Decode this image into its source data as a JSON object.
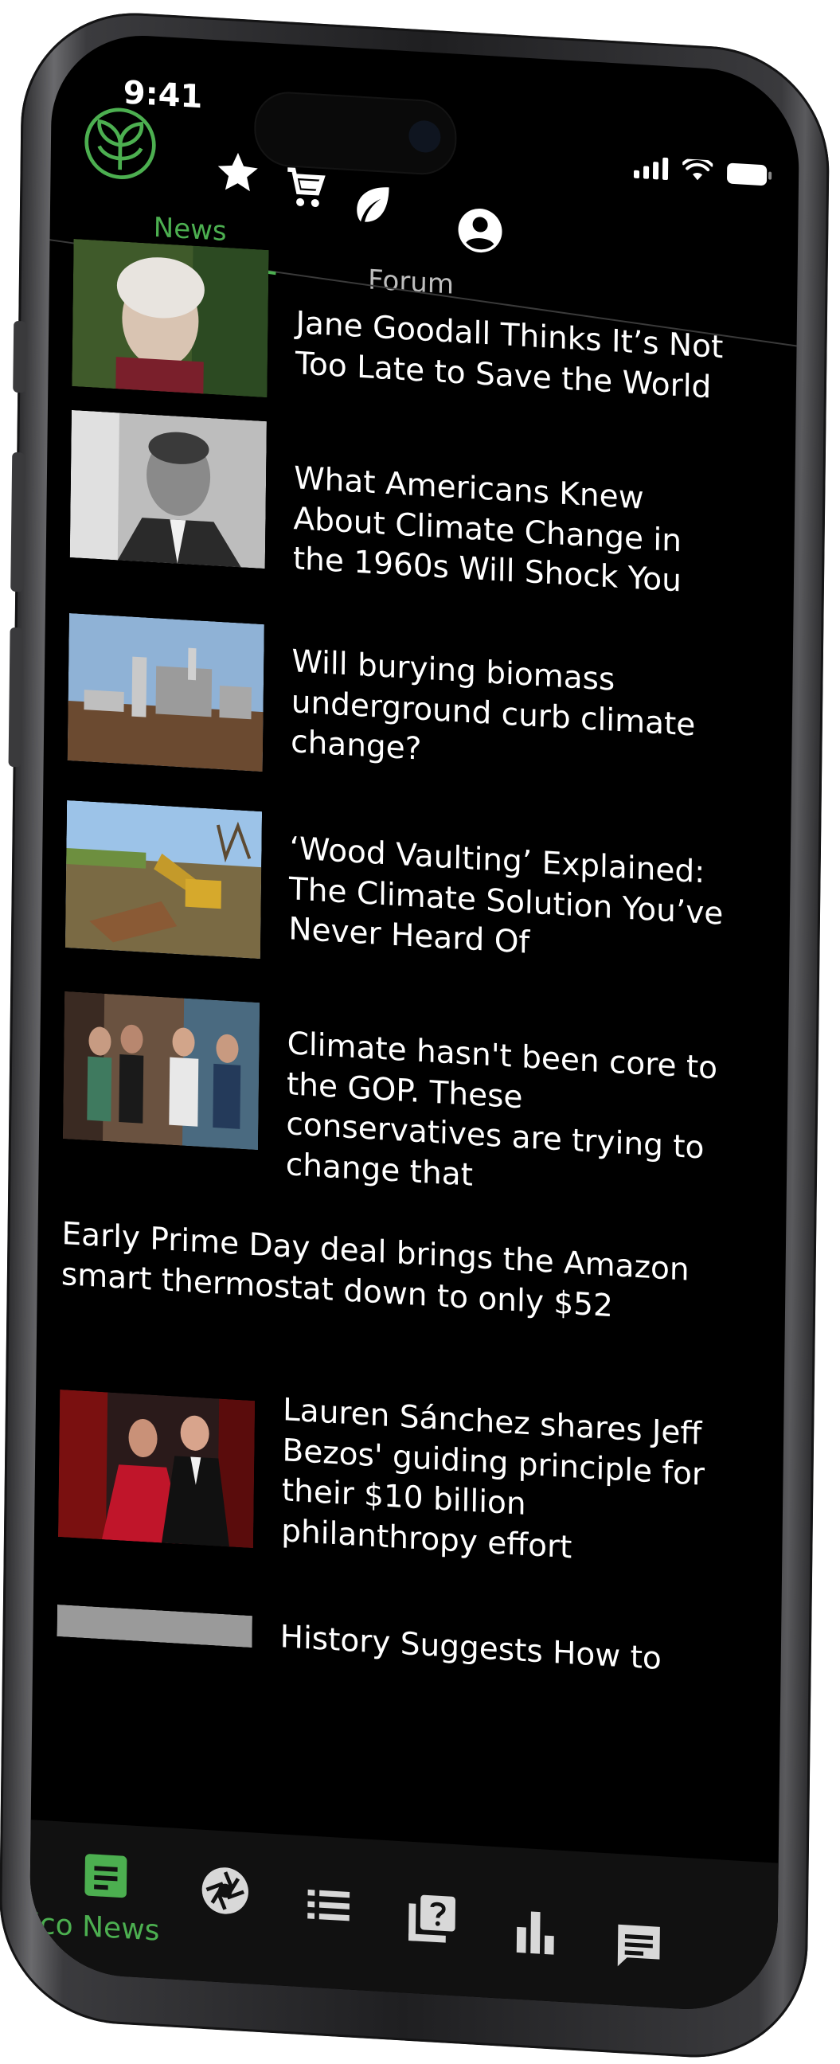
{
  "status_bar": {
    "time": "9:41"
  },
  "app": {
    "accent_color": "#4CAF50",
    "logo_icon": "leaf-sprout-logo-icon",
    "top_icons": [
      "star-icon",
      "cart-icon",
      "leaf-icon",
      "account-icon"
    ]
  },
  "tabs": [
    {
      "label": "News",
      "active": true
    },
    {
      "label": "Forum",
      "active": false
    }
  ],
  "articles": [
    {
      "title": "Jane Goodall Thinks It’s Not Too Late to Save the World",
      "has_image": true
    },
    {
      "title": "What Americans Knew About Climate Change in the 1960s Will Shock You",
      "has_image": true
    },
    {
      "title": "Will burying biomass underground curb climate change?",
      "has_image": true
    },
    {
      "title": "‘Wood Vaulting’ Explained: The Climate Solution You’ve Never Heard Of",
      "has_image": true
    },
    {
      "title": "Climate hasn't been core to the GOP. These conservatives are trying to change that",
      "has_image": true
    },
    {
      "title": "Early Prime Day deal brings the Amazon smart thermostat down to only $52",
      "has_image": false
    },
    {
      "title": "Lauren Sánchez shares Jeff Bezos' guiding principle for their $10 billion philanthropy effort",
      "has_image": true
    },
    {
      "title": "History Suggests How to",
      "has_image": true
    }
  ],
  "bottom_nav": {
    "active_label": "Eco News",
    "items": [
      "eco-news-icon",
      "camera-aperture-icon",
      "list-icon",
      "quiz-icon",
      "bar-chart-icon",
      "chat-icon"
    ]
  }
}
